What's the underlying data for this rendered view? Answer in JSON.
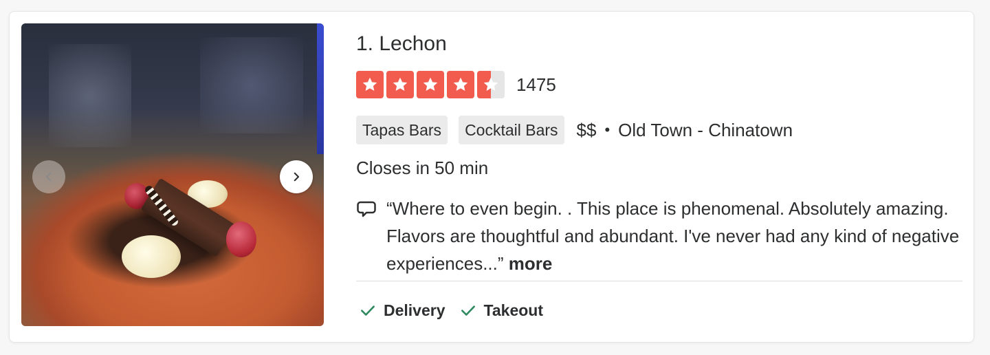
{
  "business": {
    "title": "1. Lechon",
    "rating": 4.5,
    "rating_max": 5,
    "review_count": "1475",
    "categories": [
      "Tapas Bars",
      "Cocktail Bars"
    ],
    "price": "$$",
    "separator": "•",
    "neighborhood": "Old Town - Chinatown",
    "hours_status": "Closes in 50 min",
    "snippet": "“Where to even begin. . This place is phenomenal. Absolutely amazing. Flavors are thoughtful and abundant. I've never had any kind of negative experiences...”",
    "more_label": "more",
    "amenities": [
      "Delivery",
      "Takeout"
    ]
  },
  "icons": {
    "prev": "chevron-left-icon",
    "next": "chevron-right-icon",
    "star": "star-icon",
    "snippet": "speech-bubble-icon",
    "amenity": "checkmark-icon"
  },
  "colors": {
    "star_fill": "#f15c4f",
    "star_empty": "#e6e6e6",
    "check": "#2e8a5e",
    "tag_bg": "#ebebeb"
  }
}
